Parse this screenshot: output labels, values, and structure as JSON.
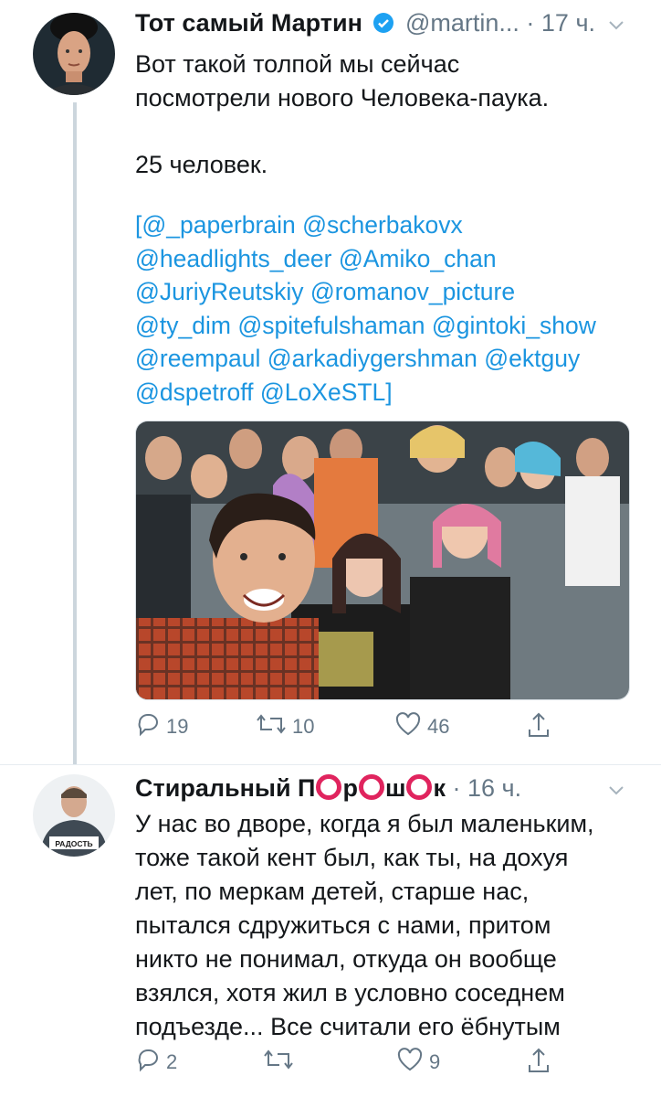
{
  "tweet1": {
    "author_name": "Тот самый Мартин",
    "handle": "@martin...",
    "time": "· 17 ч.",
    "text_lines": [
      "Вот такой толпой мы сейчас",
      "посмотрели нового Человека-паука.",
      "",
      "25 человек."
    ],
    "mentions_text": "[@_paperbrain @scherbakovx\n@headlights_deer @Amiko_chan\n@JuriyReutskiy @romanov_picture\n@ty_dim @spitefulshaman @gintoki_show\n@reempaul @arkadiygershman @ektguy\n@dspetroff @LoXeSTL]",
    "replies": "19",
    "retweets": "10",
    "likes": "46"
  },
  "tweet2": {
    "author_name_parts": [
      "Стиральный П",
      "р",
      "ш",
      "к"
    ],
    "time": "· 16 ч.",
    "avatar_shirt_text": "РАДОСТЬ",
    "text": "У нас во дворе, когда я был маленьким,\nтоже такой кент был, как ты, на дохуя\nлет, по меркам детей, старше нас,\nпытался сдружиться с нами, притом\nникто не понимал, откуда он вообще\nвзялся, хотя жил в условно соседнем\nподъезде... Все считали его ёбнутым",
    "replies": "2",
    "retweets": "",
    "likes": "9"
  },
  "colors": {
    "link": "#1b95e0",
    "secondary": "#657786",
    "verified": "#1da1f2",
    "ring_emoji": "#e0245e",
    "thread_line": "#ccd6dd"
  },
  "icons": [
    "verified-badge-icon",
    "chevron-down-icon",
    "reply-icon",
    "retweet-icon",
    "like-icon",
    "share-icon"
  ]
}
